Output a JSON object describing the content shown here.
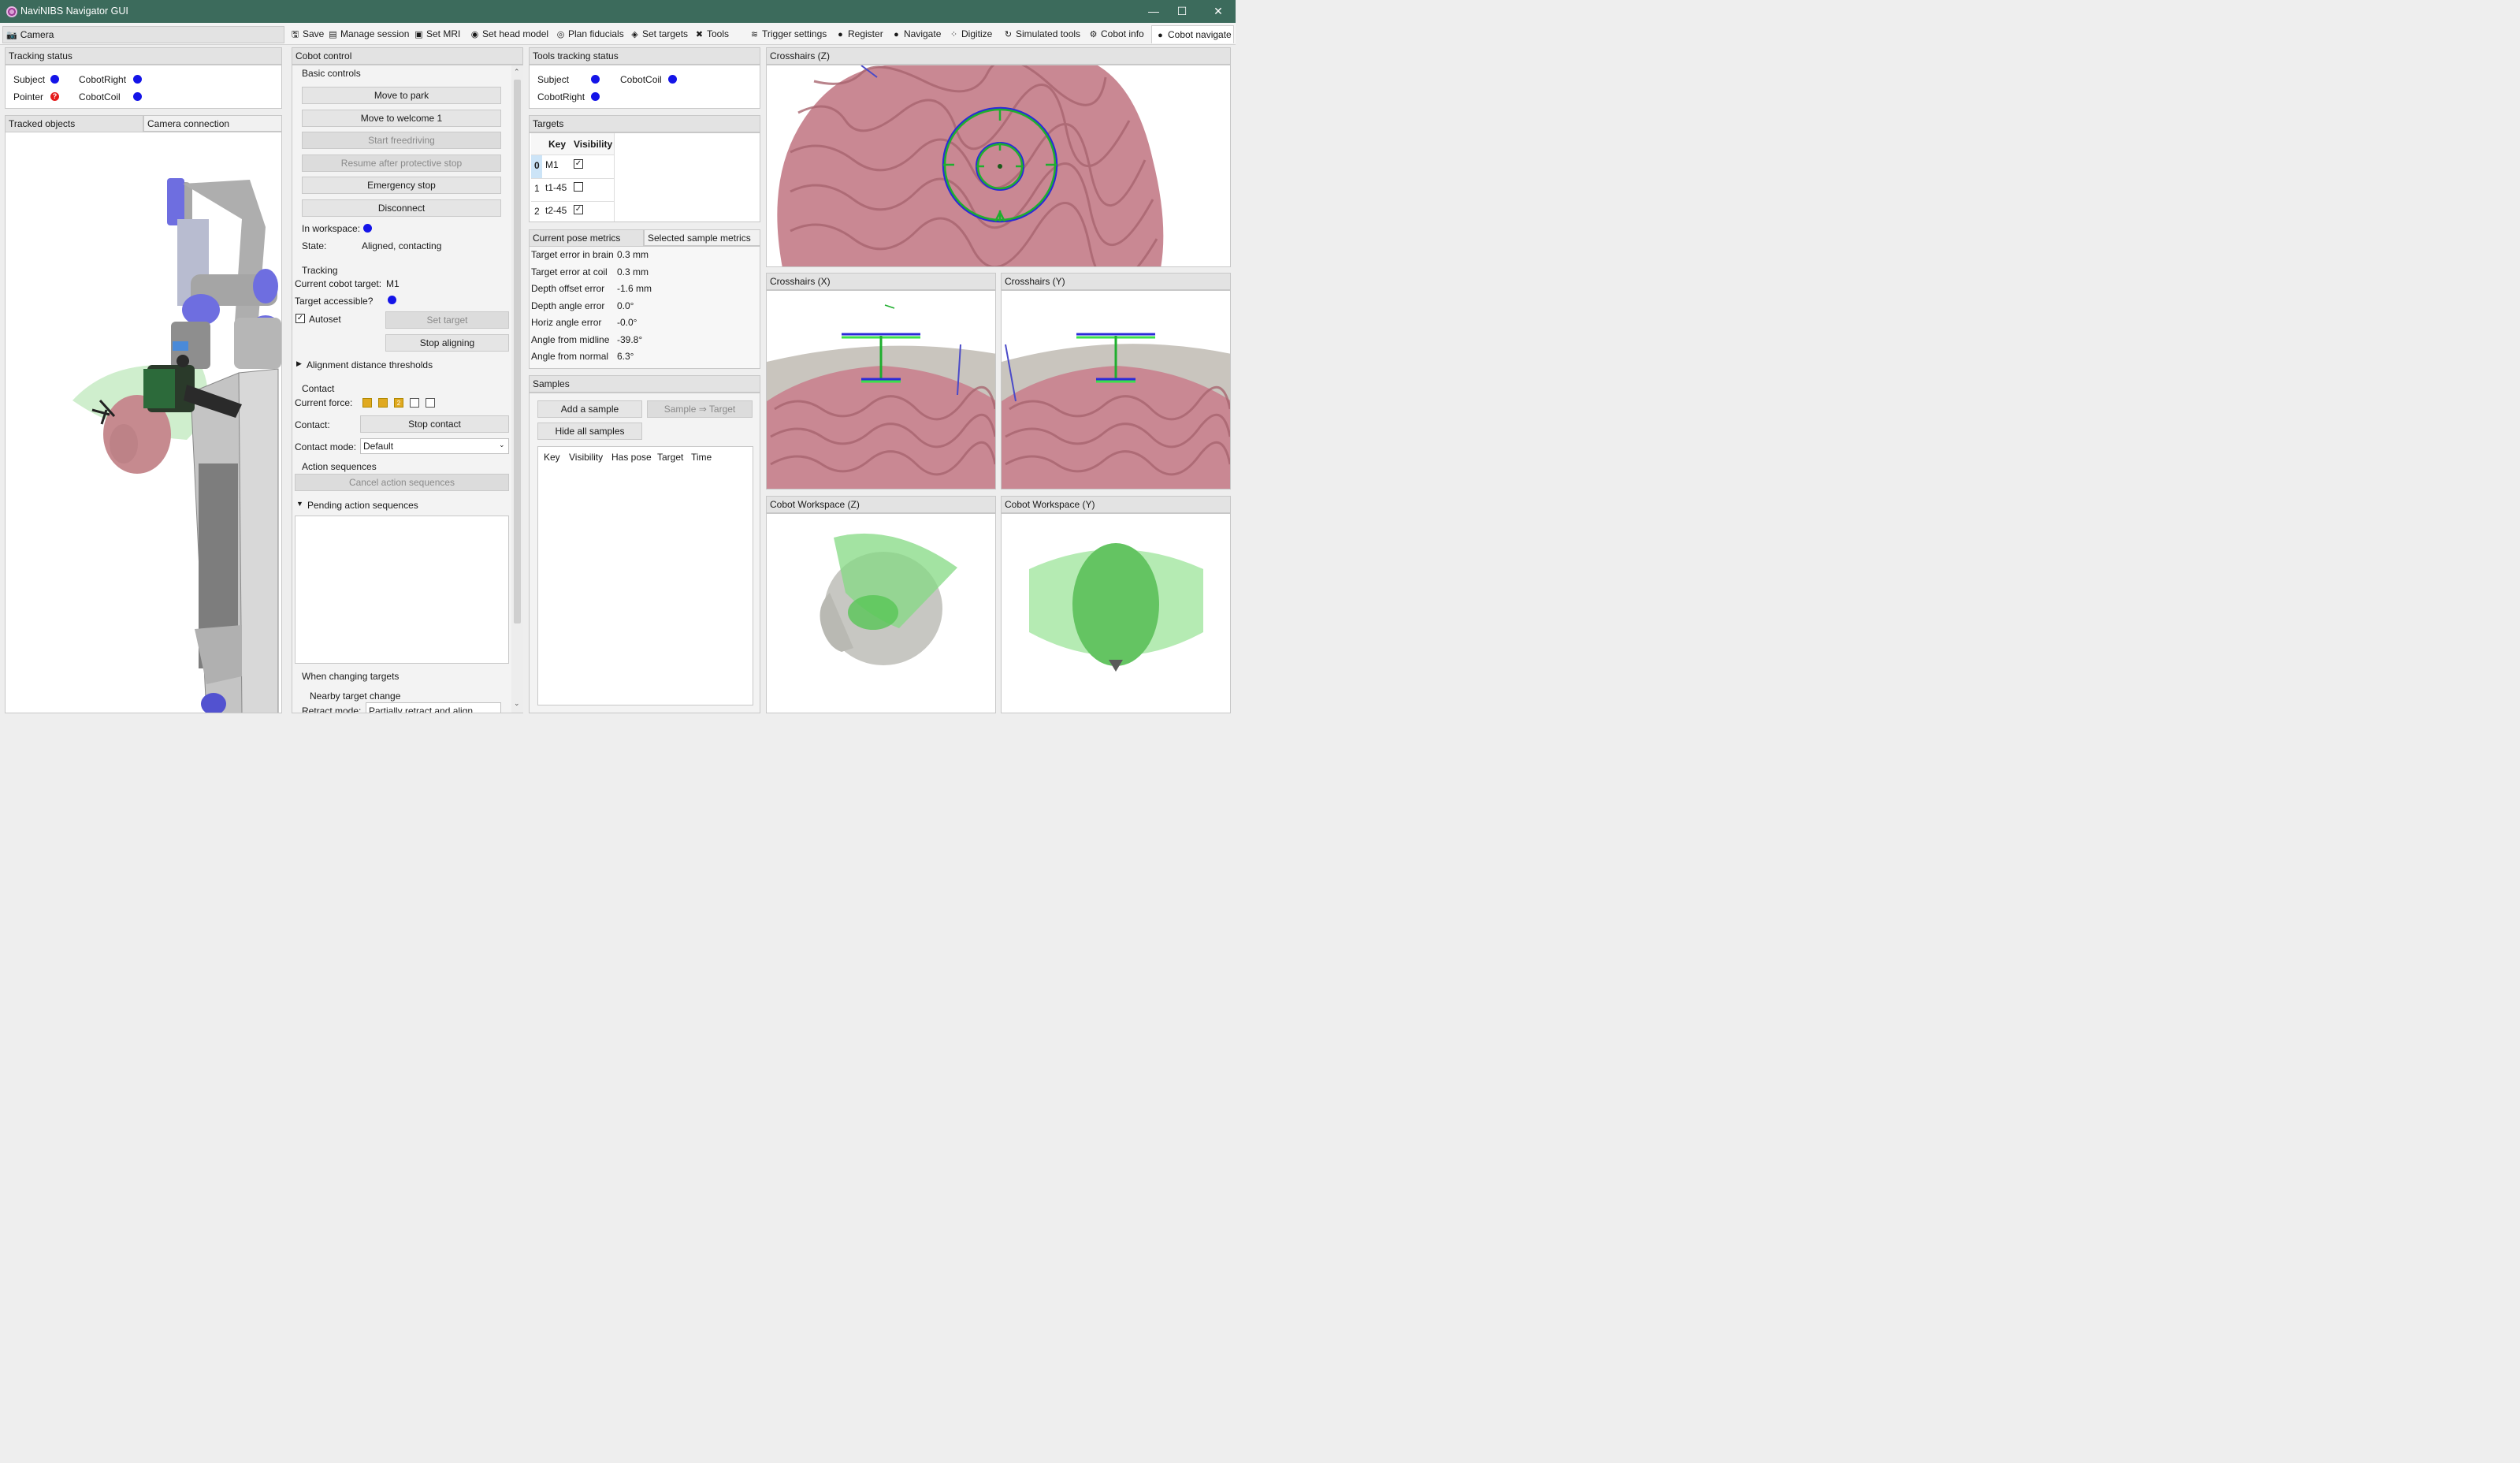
{
  "window": {
    "title": "NaviNIBS Navigator GUI",
    "minimize": "—",
    "maximize": "☐",
    "close": "✕"
  },
  "left_dock": {
    "title": "Camera"
  },
  "toolbar": {
    "items": [
      {
        "label": "Save",
        "icon": "save-icon"
      },
      {
        "label": "Manage session",
        "icon": "session-icon"
      },
      {
        "label": "Set MRI",
        "icon": "image-icon"
      },
      {
        "label": "Set head model",
        "icon": "head-icon"
      },
      {
        "label": "Plan fiducials",
        "icon": "fiducial-icon"
      },
      {
        "label": "Set targets",
        "icon": "target-icon"
      },
      {
        "label": "Tools",
        "icon": "tools-icon"
      },
      {
        "label": "Trigger settings",
        "icon": "trigger-icon"
      },
      {
        "label": "Register",
        "icon": "register-icon"
      },
      {
        "label": "Navigate",
        "icon": "navigate-icon"
      },
      {
        "label": "Digitize",
        "icon": "digitize-icon"
      },
      {
        "label": "Simulated tools",
        "icon": "simulated-icon"
      },
      {
        "label": "Cobot info",
        "icon": "cobot-icon"
      },
      {
        "label": "Cobot navigate",
        "icon": "navigate-icon"
      }
    ]
  },
  "tracking_status": {
    "title": "Tracking status",
    "items": [
      {
        "label": "Subject",
        "status": "tracked"
      },
      {
        "label": "CobotRight",
        "status": "tracked"
      },
      {
        "label": "Pointer",
        "status": "unknown",
        "badge": "?"
      },
      {
        "label": "CobotCoil",
        "status": "tracked"
      }
    ]
  },
  "camera_tabs": [
    "Tracked objects",
    "Camera connection"
  ],
  "cobot_control": {
    "title": "Cobot control",
    "basic_controls_label": "Basic controls",
    "buttons": [
      "Move to park",
      "Move to welcome 1",
      "Start freedriving",
      "Resume after protective stop",
      "Emergency stop",
      "Disconnect"
    ],
    "in_workspace_label": "In workspace:",
    "state_label": "State:",
    "state_value": "Aligned, contacting",
    "tracking_label": "Tracking",
    "current_target_label": "Current cobot target:",
    "current_target_value": "M1",
    "target_accessible_label": "Target accessible?",
    "autoset_label": "Autoset",
    "set_target_button": "Set target",
    "stop_aligning_button": "Stop aligning",
    "alignment_thresholds_label": "Alignment distance thresholds",
    "contact_section_label": "Contact",
    "current_force_label": "Current force:",
    "force_level": 3,
    "force_max": 5,
    "force_marker": "2",
    "contact_label": "Contact:",
    "stop_contact_button": "Stop contact",
    "contact_mode_label": "Contact mode:",
    "contact_mode_value": "Default",
    "action_sequences_label": "Action sequences",
    "cancel_sequences_button": "Cancel action sequences",
    "pending_sequences_label": "Pending action sequences",
    "changing_targets_label": "When changing targets",
    "nearby_target_label": "Nearby target change",
    "retract_mode_label": "Retract mode:",
    "retract_mode_value": "Partially retract and align"
  },
  "tools_tracking": {
    "title": "Tools tracking status",
    "items": [
      {
        "label": "Subject"
      },
      {
        "label": "CobotCoil"
      },
      {
        "label": "CobotRight"
      }
    ]
  },
  "targets": {
    "title": "Targets",
    "headers": [
      "Key",
      "Visibility"
    ],
    "rows": [
      {
        "index": "0",
        "key": "M1",
        "visible": true,
        "checkmark": "✓"
      },
      {
        "index": "1",
        "key": "t1-45",
        "visible": false,
        "checkmark": ""
      },
      {
        "index": "2",
        "key": "t2-45",
        "visible": true,
        "checkmark": "✓"
      }
    ]
  },
  "metrics": {
    "tabs": [
      "Current pose metrics",
      "Selected sample metrics"
    ],
    "rows": [
      {
        "label": "Target error in brain",
        "value": "0.3 mm"
      },
      {
        "label": "Target error at coil",
        "value": "0.3 mm"
      },
      {
        "label": "Depth offset error",
        "value": "-1.6 mm"
      },
      {
        "label": "Depth angle error",
        "value": "0.0°"
      },
      {
        "label": "Horiz angle error",
        "value": "-0.0°"
      },
      {
        "label": "Angle from midline",
        "value": "-39.8°"
      },
      {
        "label": "Angle from normal",
        "value": "6.3°"
      }
    ]
  },
  "samples": {
    "title": "Samples",
    "add_button": "Add a sample",
    "to_target_button": "Sample ⇒ Target",
    "hide_button": "Hide all samples",
    "headers": [
      "Key",
      "Visibility",
      "Has pose",
      "Target",
      "Time"
    ]
  },
  "views": {
    "crosshairs_z": "Crosshairs (Z)",
    "crosshairs_x": "Crosshairs (X)",
    "crosshairs_y": "Crosshairs (Y)",
    "workspace_z": "Cobot Workspace (Z)",
    "workspace_y": "Cobot Workspace (Y)"
  },
  "colors": {
    "titlebar": "#3c6b5c",
    "brain": "#c98893",
    "status_blue": "#1414e8",
    "status_red": "#e51b1b",
    "force_active": "#e0a920",
    "crosshair_green": "#1fae2e",
    "crosshair_blue": "#2a2ad8"
  }
}
